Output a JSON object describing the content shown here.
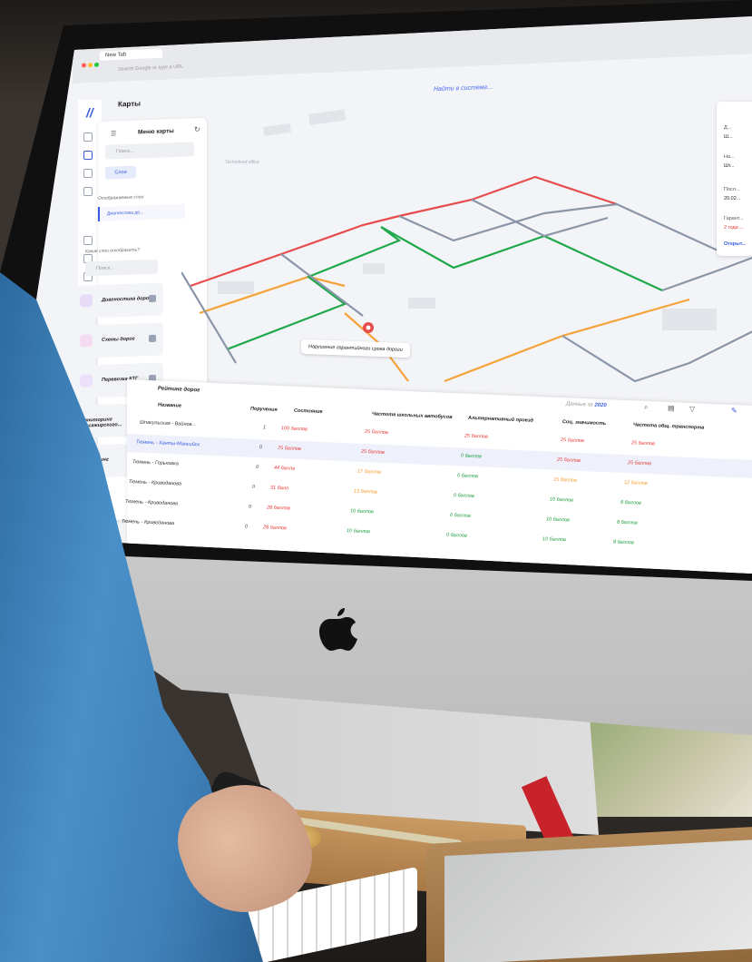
{
  "browser": {
    "tab_title": "New Tab",
    "url_placeholder": "Search Google or type a URL"
  },
  "topbar": {
    "search_label": "Найти в системе..."
  },
  "page": {
    "title": "Карты"
  },
  "layers_menu": {
    "title": "Меню карты",
    "search_placeholder": "Поиск...",
    "layers_button": "Слои",
    "displayed_label": "Отображаемые слои",
    "active_layer": "Диагностика до...",
    "which_label": "Какие слои отобразить?",
    "search2_placeholder": "Поиск...",
    "tiles": [
      {
        "label": "Диагностика дорог",
        "color": "#e6dcf8"
      },
      {
        "label": "Схемы дорог",
        "color": "#f4dcf2"
      },
      {
        "label": "Перевозка КТГ",
        "color": "#ece0fa"
      },
      {
        "label": "Мониторинг пассажирского...",
        "color": "#e6ebfb"
      },
      {
        "label": "...ониторинг",
        "color": "#e6ebfb"
      }
    ]
  },
  "map": {
    "area_label": "Technimed office",
    "tooltip": "Нарушение гарантийного срока дороги",
    "colors": {
      "red": "#e74c4c",
      "orange": "#f5a23a",
      "green": "#1fa84a",
      "gray": "#8a96a8"
    }
  },
  "info_card": {
    "rows": [
      "Д...",
      "Ш...",
      "На...",
      "Шт...",
      "Посл...",
      "20.02...",
      "Гарант...",
      "2 года ...",
      "Открыт..."
    ]
  },
  "rating": {
    "title": "Рейтинг дорог",
    "year_label": "Данные за",
    "year": "2020",
    "columns": [
      "Название",
      "Поручения",
      "Состояние",
      "Частота школьных автобусов",
      "Альтернативный проезд",
      "Соц. значимость",
      "Частота общ. транспорта"
    ],
    "rows": [
      {
        "name": "Шпакульская - Вайнов...",
        "orders": "1",
        "state": "100 баллов",
        "school": "25 баллов",
        "alt": "25 баллов",
        "social": "25 баллов",
        "transport": "25 баллов",
        "selected": false
      },
      {
        "name": "Тюмень - Ханты-Мансийск",
        "orders": "0",
        "state": "75 баллов",
        "school": "25 баллов",
        "alt": "0 баллов",
        "social": "25 баллов",
        "transport": "25 баллов",
        "selected": true
      },
      {
        "name": "Тюмень - Горьковка",
        "orders": "0",
        "state": "44 балла",
        "school": "17 баллов",
        "alt": "0 баллов",
        "social": "15 баллов",
        "transport": "12 баллов",
        "selected": false
      },
      {
        "name": "Тюмень - Криводанова",
        "orders": "0",
        "state": "31 балл",
        "school": "13 баллов",
        "alt": "0 баллов",
        "social": "10 баллов",
        "transport": "8 баллов",
        "selected": false
      },
      {
        "name": "Тюмень - Криводанова",
        "orders": "0",
        "state": "28 баллов",
        "school": "10 баллов",
        "alt": "0 баллов",
        "social": "10 баллов",
        "transport": "8 баллов",
        "selected": false
      },
      {
        "name": "Тюмень - Криводанова",
        "orders": "0",
        "state": "28 баллов",
        "school": "10 баллов",
        "alt": "0 баллов",
        "social": "10 баллов",
        "transport": "8 баллов",
        "selected": false
      }
    ]
  }
}
